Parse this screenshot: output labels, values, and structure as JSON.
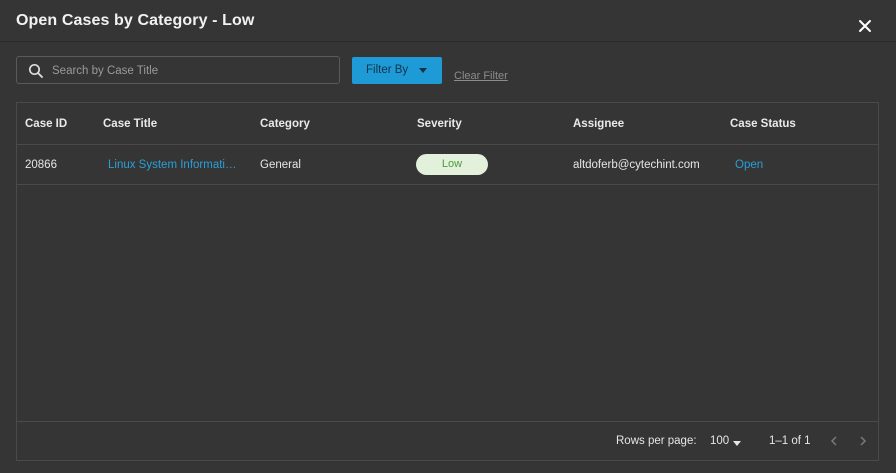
{
  "dialog": {
    "title": "Open Cases by Category - Low"
  },
  "search": {
    "placeholder": "Search by Case Title",
    "value": ""
  },
  "toolbar": {
    "filter_label": "Filter By",
    "clear_label": "Clear Filter"
  },
  "table": {
    "columns": [
      "Case ID",
      "Case Title",
      "Category",
      "Severity",
      "Assignee",
      "Case Status"
    ],
    "rows": [
      {
        "case_id": "20866",
        "case_title": "Linux System Information Discovery",
        "category": "General",
        "severity": "Low",
        "assignee": "altdoferb@cytechint.com",
        "status": "Open"
      }
    ]
  },
  "pagination": {
    "rows_per_page_label": "Rows per page:",
    "rows_per_page": "100",
    "range": "1–1 of 1"
  },
  "colors": {
    "accent": "#1e9bd7",
    "link": "#2a9fd8",
    "severity_low_bg": "#e3f1dc",
    "severity_low_text": "#4f9a3c"
  }
}
